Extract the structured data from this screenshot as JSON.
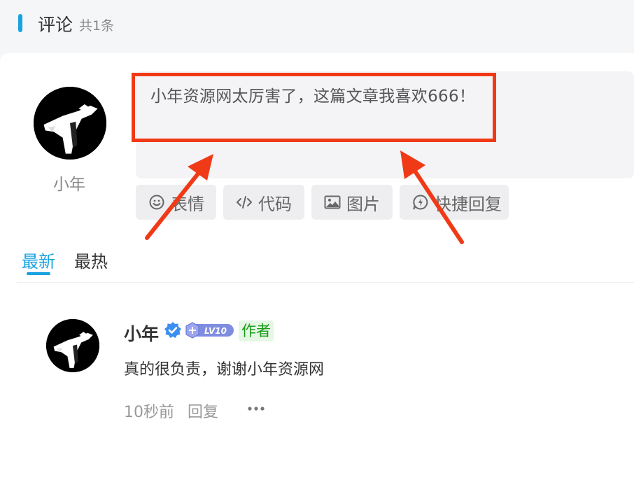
{
  "header": {
    "title": "评论",
    "count": "共1条"
  },
  "composer": {
    "user_name": "小年",
    "text_value": "小年资源网太厉害了，这篇文章我喜欢666！",
    "tools": {
      "emoji": "表情",
      "code": "代码",
      "image": "图片",
      "quick_reply": "快捷回复"
    }
  },
  "tabs": {
    "latest": "最新",
    "hot": "最热"
  },
  "comment": {
    "user_name": "小年",
    "level": "LV10",
    "author_badge": "作者",
    "text": "真的很负责，谢谢小年资源网",
    "time": "10秒前",
    "reply_label": "回复"
  },
  "colors": {
    "accent": "#1aa2e0",
    "annotation": "#f03a17",
    "author_green": "#1a9c1a"
  }
}
